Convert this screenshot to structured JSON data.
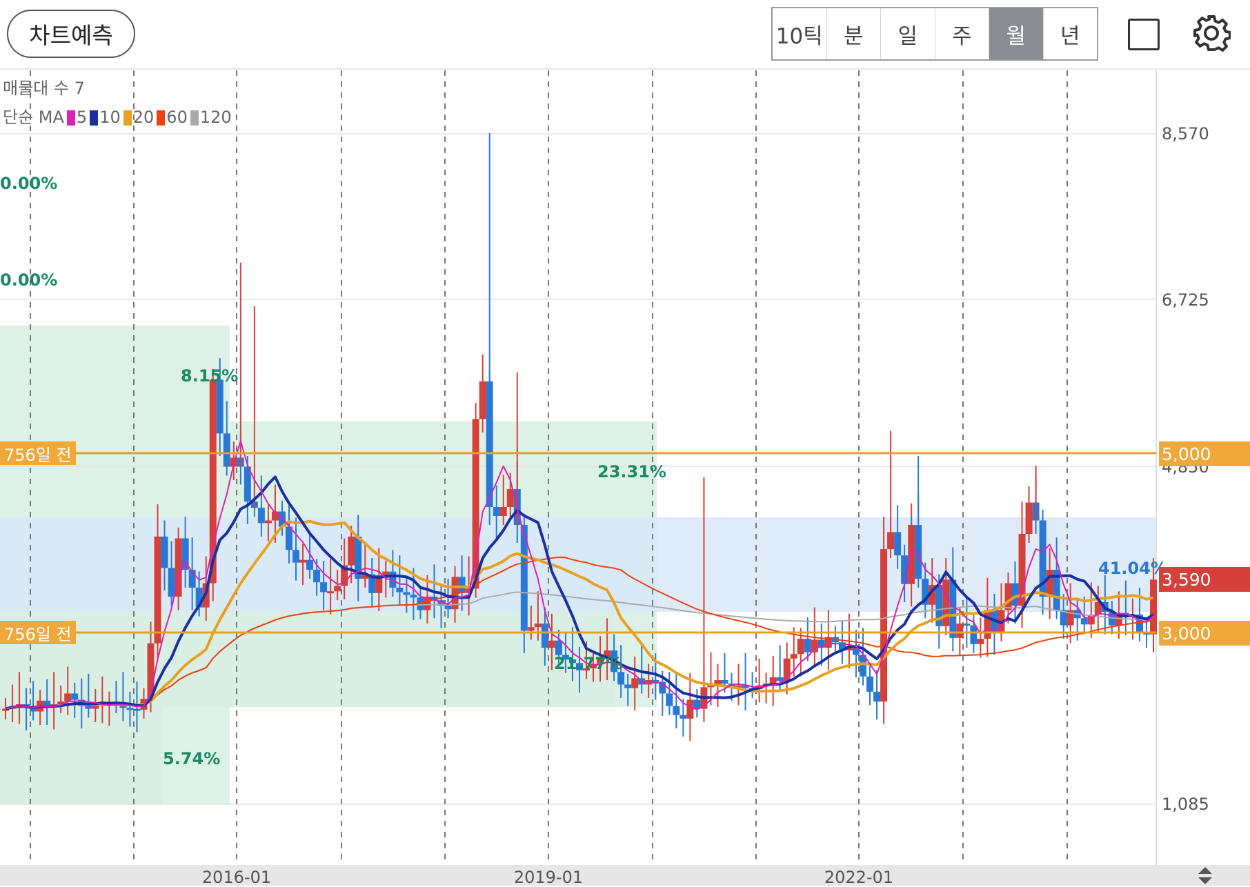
{
  "toolbar": {
    "predict_label": "차트예측",
    "tabs": [
      "10틱",
      "분",
      "일",
      "주",
      "월",
      "년"
    ],
    "active_tab": "월"
  },
  "legend": {
    "line1": "매물대 수 7",
    "ma_prefix": "단순 MA",
    "ma": [
      {
        "period": "5",
        "color": "#e020b0"
      },
      {
        "period": "10",
        "color": "#1a2fa0"
      },
      {
        "period": "20",
        "color": "#e8a020"
      },
      {
        "period": "60",
        "color": "#f04010"
      },
      {
        "period": "120",
        "color": "#aaaaaa"
      }
    ]
  },
  "levels": {
    "upper_label": "756일 전",
    "upper_value": "5,000",
    "lower_label": "756일 전",
    "lower_value": "3,000",
    "current_value": "3,590"
  },
  "percent_labels": {
    "a": "0.00%",
    "b": "0.00%",
    "c": "8.15%",
    "d": "23.31%",
    "e": "21.77%",
    "f": "5.74%",
    "g": "41.04%"
  },
  "chart_data": {
    "type": "candlestick",
    "interval": "monthly",
    "y_ticks": [
      "8,570",
      "6,725",
      "4,850",
      "1,085"
    ],
    "x_ticks": [
      "2016-01",
      "2019-01",
      "2022-01"
    ],
    "colors": {
      "up": "#d6403a",
      "down": "#2a78d6",
      "horizontal_line": "#e8a020"
    },
    "closes": [
      2150,
      2180,
      2200,
      2160,
      2120,
      2240,
      2170,
      2200,
      2230,
      2320,
      2250,
      2180,
      2150,
      2190,
      2210,
      2220,
      2200,
      2160,
      2150,
      2140,
      2260,
      2880,
      4070,
      3720,
      3400,
      4050,
      3700,
      3500,
      3280,
      3550,
      5820,
      5220,
      4850,
      4950,
      4850,
      4460,
      4390,
      4220,
      4250,
      4350,
      4180,
      3920,
      3780,
      3810,
      3700,
      3560,
      3450,
      3460,
      3520,
      3750,
      4070,
      3600,
      3650,
      3440,
      3640,
      3680,
      3500,
      3450,
      3420,
      3390,
      3250,
      3400,
      3360,
      3300,
      3260,
      3620,
      3440,
      3490,
      5380,
      5800,
      4400,
      4300,
      4400,
      4600,
      4200,
      3020,
      3060,
      3100,
      2830,
      2910,
      2750,
      2700,
      2660,
      2580,
      2600,
      2650,
      2720,
      2800,
      2560,
      2420,
      2380,
      2490,
      2420,
      2470,
      2450,
      2320,
      2180,
      2080,
      2040,
      2250,
      2150,
      2390,
      2420,
      2470,
      2430,
      2390,
      2410,
      2380,
      2370,
      2410,
      2430,
      2500,
      2460,
      2710,
      2760,
      2930,
      2780,
      2920,
      2830,
      2950,
      2890,
      2800,
      2850,
      2750,
      2510,
      2340,
      2230,
      3930,
      4120,
      3860,
      3540,
      4200,
      3600,
      3310,
      3530,
      3070,
      3590,
      2940,
      3100,
      3080,
      2870,
      2930,
      3250,
      3000,
      3250,
      3550,
      3300,
      4100,
      4450,
      4250,
      3400,
      3700,
      3250,
      3080,
      3250,
      3160,
      3090,
      3200,
      3340,
      3230,
      3080,
      3220,
      3170,
      3200,
      3000,
      2980,
      3590
    ],
    "ma": {
      "5": "series",
      "10": "series",
      "20": "series",
      "60": "series",
      "120": "series"
    }
  }
}
